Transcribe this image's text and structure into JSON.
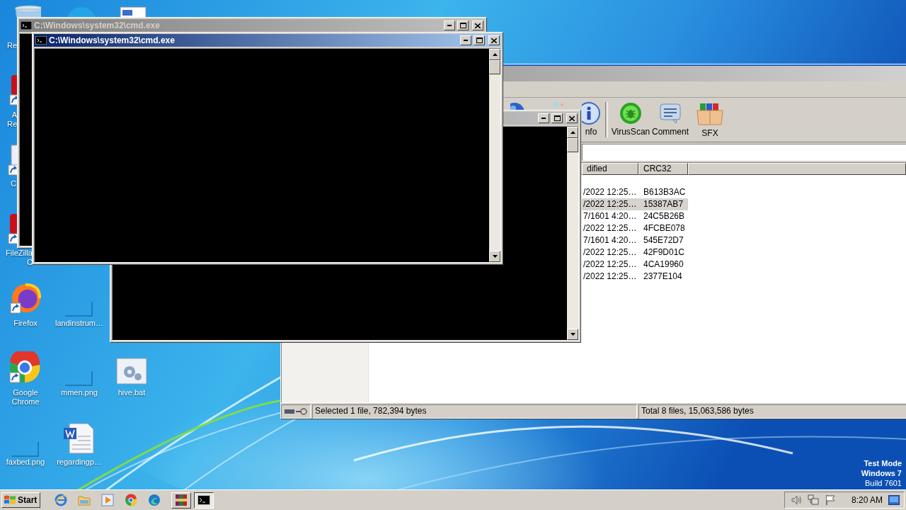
{
  "desktop": {
    "icons": [
      {
        "kind": "recycle",
        "label": "Re"
      },
      {
        "kind": "skype"
      },
      {
        "kind": "document"
      },
      {
        "kind": "red-app",
        "label": "A\nRe"
      },
      {
        "kind": "shortcut",
        "label": "C"
      },
      {
        "kind": "red-app",
        "label": "FileZilla C"
      },
      {
        "kind": "firefox",
        "label": "Firefox"
      },
      {
        "kind": "thumbnail",
        "label": "landinstrum…"
      },
      {
        "kind": "chrome",
        "label": "Google\nChrome"
      },
      {
        "kind": "thumbnail",
        "label": "mmen.png"
      },
      {
        "kind": "batch",
        "label": "hive.bat"
      },
      {
        "kind": "thumbnail",
        "label": "faxbed.png"
      },
      {
        "kind": "word",
        "label": "regardingp…"
      }
    ],
    "system_info": [
      "Test Mode",
      "Windows 7",
      "Build 7601"
    ]
  },
  "console_windows": [
    {
      "title": "C:\\Windows\\system32\\cmd.exe",
      "active": false
    },
    {
      "title": "C:\\Windows\\system32\\cmd.exe",
      "active": true
    },
    {
      "active": false
    }
  ],
  "archiver": {
    "toolbar": [
      {
        "kind": "globe"
      },
      {
        "kind": "wizard"
      },
      {
        "kind": "info",
        "label": "nfo"
      },
      {
        "kind": "separator"
      },
      {
        "kind": "virus",
        "label": "VirusScan"
      },
      {
        "kind": "comment",
        "label": "Comment"
      },
      {
        "kind": "sfx",
        "label": "SFX"
      }
    ],
    "columns": [
      "dified",
      "CRC32"
    ],
    "rows": [
      {
        "cells": [
          "/2022 12:25…",
          "B613B3AC"
        ],
        "selected": false
      },
      {
        "cells": [
          "/2022 12:25…",
          "15387AB7"
        ],
        "selected": true
      },
      {
        "cells": [
          "7/1601 4:20…",
          "24C5B26B"
        ],
        "selected": false
      },
      {
        "cells": [
          "/2022 12:25…",
          "4FCBE078"
        ],
        "selected": false
      },
      {
        "cells": [
          "7/1601 4:20…",
          "545E72D7"
        ],
        "selected": false
      },
      {
        "cells": [
          "/2022 12:25…",
          "42F9D01C"
        ],
        "selected": false
      },
      {
        "cells": [
          "/2022 12:25…",
          "4CA19960"
        ],
        "selected": false
      },
      {
        "cells": [
          "/2022 12:25…",
          "2377E104"
        ],
        "selected": false
      }
    ],
    "status_bar": [
      "Selected 1 file, 782,394 bytes",
      "Total 8 files, 15,063,586 bytes"
    ]
  },
  "taskbar": {
    "start": "Start",
    "quick_launch": [
      {
        "kind": "ie"
      },
      {
        "kind": "folder"
      },
      {
        "kind": "media"
      },
      {
        "kind": "chrome"
      },
      {
        "kind": "edge"
      }
    ],
    "tasks": [
      {
        "kind": "winrar",
        "selected": false
      },
      {
        "kind": "cmd",
        "selected": true
      }
    ],
    "tray": [
      {
        "kind": "speaker"
      },
      {
        "kind": "network"
      },
      {
        "kind": "flag"
      }
    ],
    "clock": "8:20 AM"
  }
}
